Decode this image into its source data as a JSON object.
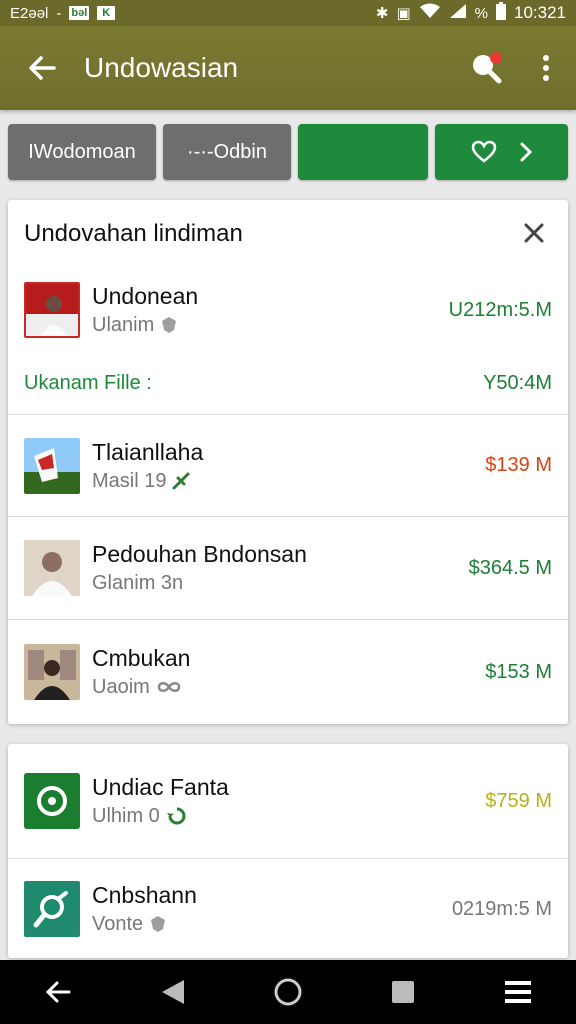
{
  "status_bar": {
    "left_text": "E2əəl",
    "left_dash": "-",
    "left_box": "bəl",
    "left_box2": "K",
    "percent": "%",
    "time": "10:321"
  },
  "app_bar": {
    "title": "Undowasian"
  },
  "chips": [
    {
      "label": "IWodomoan"
    },
    {
      "label": "·-·-Odbin"
    },
    {
      "label": ""
    },
    {
      "label": ""
    }
  ],
  "card1": {
    "title": "Undovahan lindiman",
    "items": [
      {
        "title": "Undonean",
        "subtitle": "Ulanim",
        "value": "U212m:5.M"
      },
      {
        "title": "Tlaianllaha",
        "subtitle": "Masil 19",
        "value": "$139 M"
      },
      {
        "title": "Pedouhan Bndonsan",
        "subtitle": "Glanim 3n",
        "value": "$364.5 M"
      },
      {
        "title": "Cmbukan",
        "subtitle": "Uaoim",
        "value": "$153 M"
      }
    ],
    "file_row": {
      "label": "Ukanam Fille",
      "suffix": ":",
      "value": "Y50:4M"
    }
  },
  "card2": {
    "items": [
      {
        "title": "Undiac Fanta",
        "subtitle": "Ulhim 0",
        "value": "$759 M"
      },
      {
        "title": "Cnbshann",
        "subtitle": "Vonte",
        "value": "0219m:5 M"
      }
    ]
  },
  "colors": {
    "app_bar": "#7b7a33",
    "chip_gray": "#6e6e6e",
    "chip_green": "#1e8a3c",
    "value_green": "#1e7e34",
    "value_red": "#d84315"
  }
}
